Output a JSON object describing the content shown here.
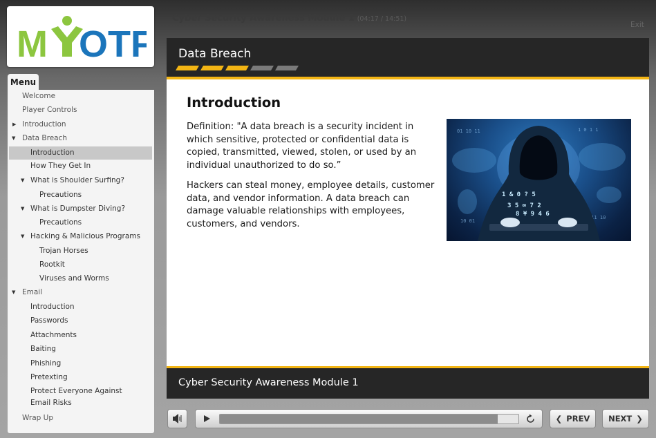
{
  "logo": {
    "text": "MYOTF"
  },
  "menu": {
    "tab_label": "Menu",
    "items": [
      {
        "label": "Welcome"
      },
      {
        "label": "Player Controls"
      },
      {
        "label": "Introduction"
      },
      {
        "label": "Data Breach"
      },
      {
        "label": "Introduction"
      },
      {
        "label": "How They Get In"
      },
      {
        "label": "What is Shoulder Surfing?"
      },
      {
        "label": "Precautions"
      },
      {
        "label": "What is Dumpster Diving?"
      },
      {
        "label": "Precautions"
      },
      {
        "label": "Hacking & Malicious Programs"
      },
      {
        "label": "Trojan Horses"
      },
      {
        "label": "Rootkit"
      },
      {
        "label": "Viruses and Worms"
      },
      {
        "label": "Email"
      },
      {
        "label": "Introduction"
      },
      {
        "label": "Passwords"
      },
      {
        "label": "Attachments"
      },
      {
        "label": "Baiting"
      },
      {
        "label": "Phishing"
      },
      {
        "label": "Pretexting"
      },
      {
        "label": "Protect Everyone Against Email Risks"
      },
      {
        "label": "Wrap Up"
      }
    ],
    "active_index": 4
  },
  "header": {
    "course_title": "Cyber Security Awareness Module 1",
    "time": "(04:17 / 14:51)",
    "exit_label": "Exit"
  },
  "slide": {
    "section_title": "Data Breach",
    "progress_segments": {
      "completed": 3,
      "total": 5
    },
    "heading": "Introduction",
    "paragraphs": [
      "Definition: \"A data breach is a security incident in which sensitive, protected or confidential data is copied, transmitted, viewed, stolen, or used by an individual unauthorized to do so.”",
      "Hackers can steal money, employee details, customer data, and vendor information. A data breach can damage valuable relationships with employees, customers, and vendors."
    ],
    "image_icon": "hooded-hacker-image",
    "footer_title": "Cyber Security Awareness Module 1"
  },
  "player": {
    "volume_icon": "speaker-icon",
    "play_icon": "play-icon",
    "replay_icon": "replay-icon",
    "progress_fraction": 0.93,
    "prev_label": "PREV",
    "next_label": "NEXT"
  },
  "colors": {
    "accent": "#f3b514",
    "logo_green": "#8cc63f",
    "logo_blue": "#1b75bb",
    "header_bg": "#262626"
  }
}
